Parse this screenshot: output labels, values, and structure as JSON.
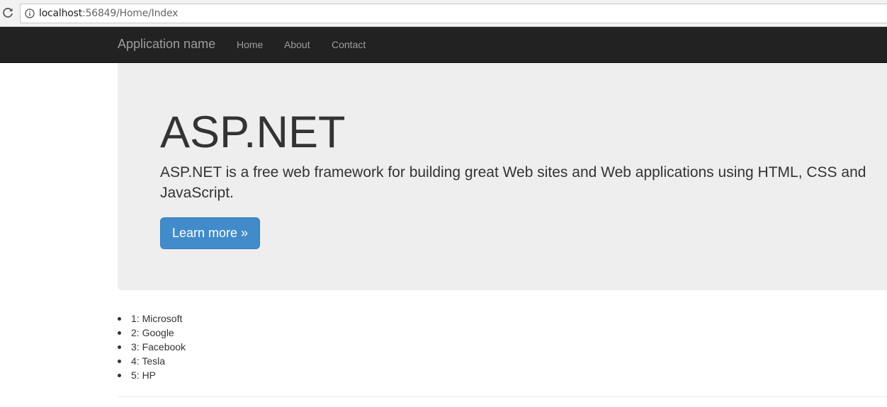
{
  "browser": {
    "url_host": "localhost",
    "url_rest": ":56849/Home/Index",
    "icons": [
      "reload-icon",
      "info-icon"
    ]
  },
  "navbar": {
    "brand": "Application name",
    "links": [
      "Home",
      "About",
      "Contact"
    ],
    "background": "#222222",
    "link_color": "#9d9d9d"
  },
  "jumbotron": {
    "title": "ASP.NET",
    "lead": "ASP.NET is a free web framework for building great Web sites and Web applications using HTML, CSS and JavaScript.",
    "button_label": "Learn more »",
    "button_color": "#428bca",
    "background": "#eeeeee"
  },
  "companies": [
    "1: Microsoft",
    "2: Google",
    "3: Facebook",
    "4: Tesla",
    "5: HP"
  ]
}
